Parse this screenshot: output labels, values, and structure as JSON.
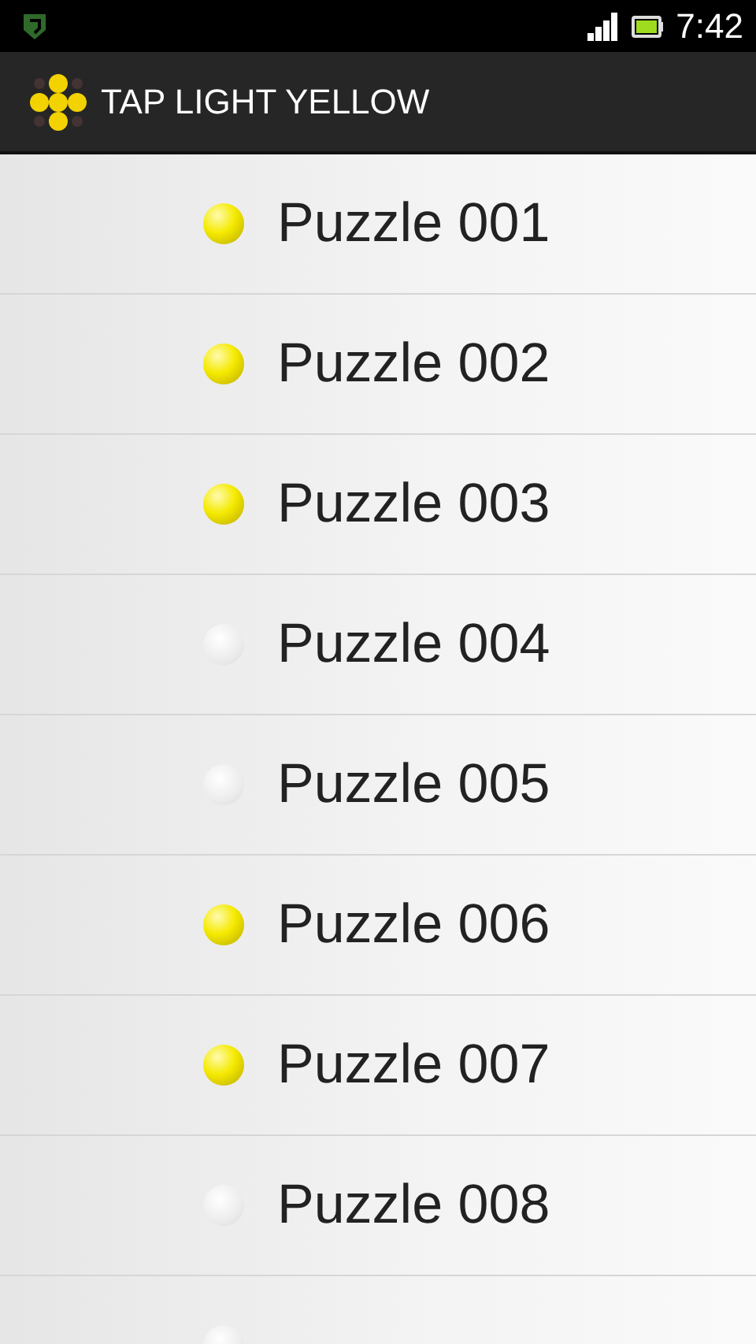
{
  "status_bar": {
    "time": "7:42"
  },
  "app_bar": {
    "title": "TAP LIGHT YELLOW"
  },
  "puzzles": [
    {
      "label": "Puzzle 001",
      "solved": true
    },
    {
      "label": "Puzzle 002",
      "solved": true
    },
    {
      "label": "Puzzle 003",
      "solved": true
    },
    {
      "label": "Puzzle 004",
      "solved": false
    },
    {
      "label": "Puzzle 005",
      "solved": false
    },
    {
      "label": "Puzzle 006",
      "solved": true
    },
    {
      "label": "Puzzle 007",
      "solved": true
    },
    {
      "label": "Puzzle 008",
      "solved": false
    },
    {
      "solved": false
    }
  ]
}
